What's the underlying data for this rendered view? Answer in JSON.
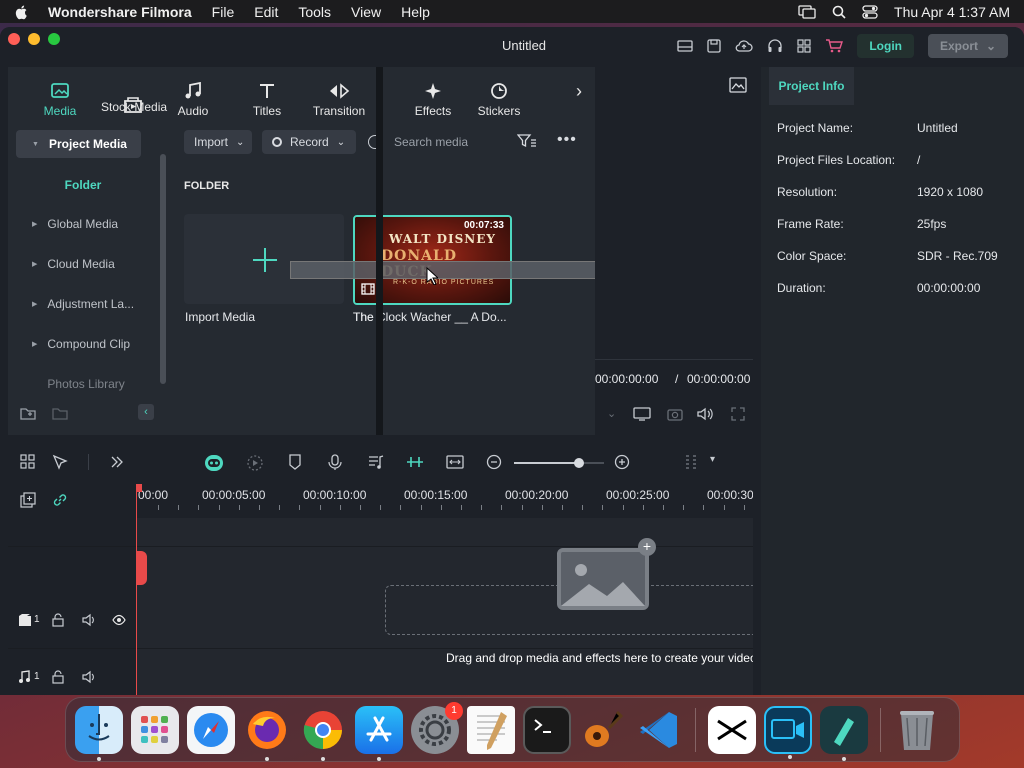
{
  "menubar": {
    "app_name": "Wondershare Filmora",
    "items": [
      "File",
      "Edit",
      "Tools",
      "View",
      "Help"
    ],
    "datetime": "Thu Apr 4  1:37 AM"
  },
  "window": {
    "title": "Untitled",
    "login_label": "Login",
    "export_label": "Export"
  },
  "tabs": [
    {
      "label": "Media",
      "icon": "media-icon",
      "active": true
    },
    {
      "label": "Stock Media",
      "icon": "stock-media-icon"
    },
    {
      "label": "Audio",
      "icon": "music-note-icon"
    },
    {
      "label": "Titles",
      "icon": "text-t-icon"
    },
    {
      "label": "Transition",
      "icon": "transition-icon"
    },
    {
      "label": "Effects",
      "icon": "sparkle-icon"
    },
    {
      "label": "Stickers",
      "icon": "sticker-icon"
    }
  ],
  "sidebar": {
    "project_media": "Project Media",
    "folder": "Folder",
    "items": [
      "Global Media",
      "Cloud Media",
      "Adjustment La...",
      "Compound Clip",
      "Photos Library"
    ]
  },
  "media": {
    "import_label": "Import",
    "record_label": "Record",
    "search_placeholder": "Search media",
    "folder_header": "FOLDER",
    "import_tile_label": "Import Media",
    "clip_name": "The Clock Wacher __ A Do...",
    "clip_duration": "00:07:33",
    "clip_thumb_line1": "WALT DISNEY",
    "clip_thumb_line2": "DONALD DUCK",
    "clip_thumb_line3": "R-K-O RADIO PICTURES"
  },
  "player": {
    "current_time": "00:00:00:00",
    "separator": "/",
    "total_time": "00:00:00:00"
  },
  "project_info": {
    "tab_label": "Project Info",
    "rows": [
      {
        "label": "Project Name:",
        "value": "Untitled"
      },
      {
        "label": "Project Files Location:",
        "value": "/"
      },
      {
        "label": "Resolution:",
        "value": "1920 x 1080"
      },
      {
        "label": "Frame Rate:",
        "value": "25fps"
      },
      {
        "label": "Color Space:",
        "value": "SDR - Rec.709"
      },
      {
        "label": "Duration:",
        "value": "00:00:00:00"
      }
    ]
  },
  "timeline": {
    "ruler_labels": [
      "00:00",
      "00:00:05:00",
      "00:00:10:00",
      "00:00:15:00",
      "00:00:20:00",
      "00:00:25:00",
      "00:00:30"
    ],
    "drop_hint": "Drag and drop media and effects here to create your video.",
    "video_track_number": "1",
    "audio_track_number": "1",
    "zoom_level": 0.72
  },
  "dock": {
    "apps": [
      "Finder",
      "Launchpad",
      "Safari",
      "Firefox",
      "Chrome",
      "App Store",
      "System Settings",
      "TextEdit",
      "Terminal",
      "GarageBand",
      "VS Code",
      "CapCut",
      "Screen Recorder",
      "Filmora",
      "Trash"
    ],
    "settings_badge": "1"
  },
  "colors": {
    "accent": "#4ed8c0",
    "panel": "#252a31",
    "window_bg": "#1d2128",
    "playhead": "#e84a4a"
  }
}
